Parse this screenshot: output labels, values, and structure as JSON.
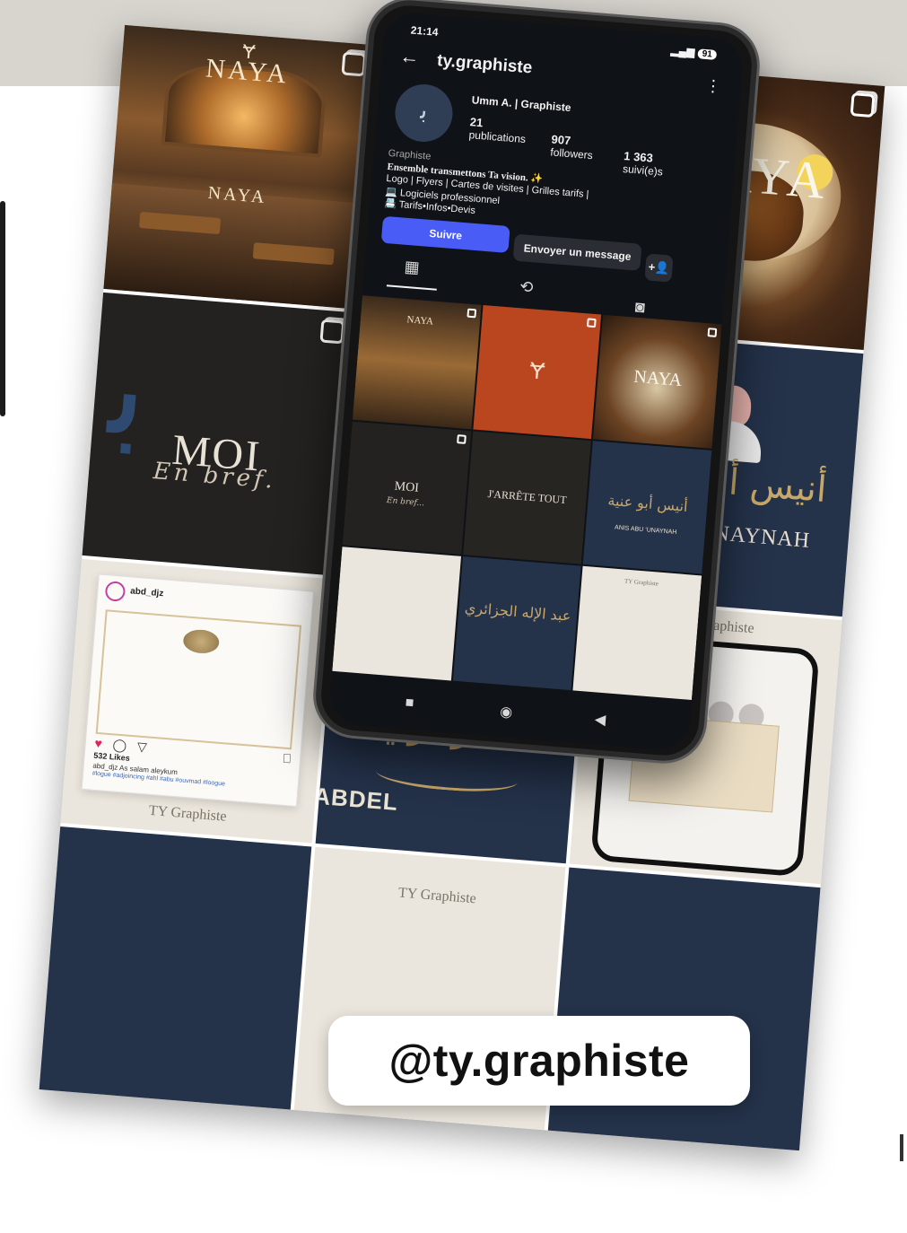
{
  "page": {
    "handle_badge": "@ty.graphiste"
  },
  "posts": {
    "restaurant": {
      "brand": "NAYA",
      "symbol": "Ɏ"
    },
    "food": {
      "brand": "NAYA"
    },
    "moi": {
      "title": "MOI",
      "subtitle": "En bref."
    },
    "anis": {
      "arabic": "أنيس أبو عنية",
      "latin": "ABU ‘UNAYNAH"
    },
    "abdel": {
      "arabic": "عبد الإله الجزائري",
      "latin": "ABDEL"
    },
    "igcard": {
      "username": "abd_djz",
      "likes": "532 Likes",
      "caption": "abd_djz As salam aleykum",
      "tags": "#logue #adjoincing #ahl #abu #ouvmad #loogue",
      "signature": "TY Graphiste"
    },
    "mockup": {
      "signature": "TY Graphiste"
    },
    "bottom_sign": "TY Graphiste"
  },
  "phone": {
    "status": {
      "time": "21:14",
      "battery": "91"
    },
    "header": {
      "handle": "ty.graphiste"
    },
    "profile": {
      "display_name": "Umm A. | Graphiste",
      "posts_count": "21",
      "posts_label": "publications",
      "followers_count": "907",
      "followers_label": "followers",
      "following_count": "1 363",
      "following_label": "suivi(e)s",
      "category": "Graphiste",
      "bio_line1": "Ensemble transmettons Ta vision. ✨",
      "bio_line2": "Logo | Flyers | Cartes de visites | Grilles tarifs |",
      "bio_line3": "💻 Logiciels professionnel",
      "bio_line4": "📇 Tarifs•Infos•Devis"
    },
    "buttons": {
      "follow": "Suivre",
      "message": "Envoyer un message",
      "add_user": "+👤"
    },
    "grid": {
      "naya": "NAYA",
      "moi": "MOI",
      "moi_sub": "En bref...",
      "arrete": "J'ARRÊTE TOUT",
      "anis": "ANIS ABU ‘UNAYNAH",
      "mockup_sign": "TY Graphiste"
    }
  },
  "icons": {
    "back": "←",
    "more": "⋮",
    "grid": "▦",
    "reels": "⟲",
    "tagged": "◙",
    "nav_recent": "■",
    "nav_home": "◉",
    "nav_back": "◀",
    "heart": "♥",
    "comment": "◯",
    "share": "▽",
    "bookmark": "⎕"
  },
  "colors": {
    "follow_button": "#4a5cf6",
    "screen_bg": "#0f1217",
    "navy": "#24324a",
    "orange": "#b9461f",
    "gold": "#c8a86a",
    "top_band": "#d8d5cf"
  }
}
